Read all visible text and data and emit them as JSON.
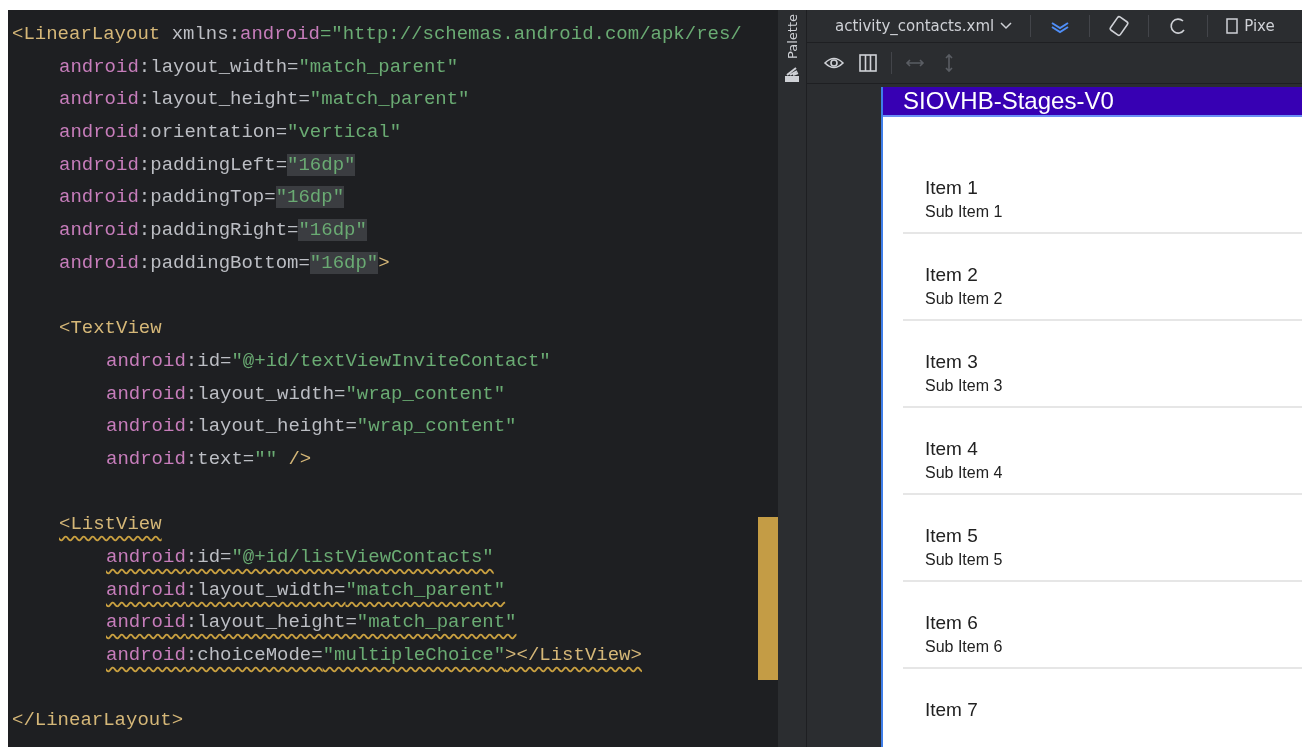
{
  "editor": {
    "lines": [
      {
        "kind": "code",
        "tokens": [
          {
            "kind": "tag",
            "text": "<LinearLayout"
          },
          {
            "kind": "plain",
            "text": " xmlns:"
          },
          {
            "kind": "ns",
            "text": "android"
          },
          {
            "kind": "value",
            "text": "=\"http://schemas.android.com/apk/res/"
          }
        ],
        "children": [
          {
            "kind": "code",
            "tokens": [
              {
                "kind": "ns",
                "text": "android"
              },
              {
                "kind": "plain",
                "text": ":layout_width="
              },
              {
                "kind": "value",
                "text": "\"match_parent\""
              }
            ]
          },
          {
            "kind": "code",
            "tokens": [
              {
                "kind": "ns",
                "text": "android"
              },
              {
                "kind": "plain",
                "text": ":layout_height="
              },
              {
                "kind": "value",
                "text": "\"match_parent\""
              }
            ]
          },
          {
            "kind": "code",
            "tokens": [
              {
                "kind": "ns",
                "text": "android"
              },
              {
                "kind": "plain",
                "text": ":orientation="
              },
              {
                "kind": "value",
                "text": "\"vertical\""
              }
            ]
          },
          {
            "kind": "code",
            "tokens": [
              {
                "kind": "ns",
                "text": "android"
              },
              {
                "kind": "plain",
                "text": ":paddingLeft="
              },
              {
                "kind": "value",
                "text": "\"16dp\"",
                "highlighted": true
              }
            ]
          },
          {
            "kind": "code",
            "tokens": [
              {
                "kind": "ns",
                "text": "android"
              },
              {
                "kind": "plain",
                "text": ":paddingTop="
              },
              {
                "kind": "value",
                "text": "\"16dp\"",
                "highlighted": true
              }
            ]
          },
          {
            "kind": "code",
            "tokens": [
              {
                "kind": "ns",
                "text": "android"
              },
              {
                "kind": "plain",
                "text": ":paddingRight="
              },
              {
                "kind": "value",
                "text": "\"16dp\"",
                "highlighted": true
              }
            ]
          },
          {
            "kind": "code",
            "tokens": [
              {
                "kind": "ns",
                "text": "android"
              },
              {
                "kind": "plain",
                "text": ":paddingBottom="
              },
              {
                "kind": "value",
                "text": "\"16dp\"",
                "highlighted": true
              },
              {
                "kind": "tag",
                "text": ">"
              }
            ]
          },
          {
            "kind": "blank"
          },
          {
            "kind": "code",
            "tokens": [
              {
                "kind": "tag",
                "text": "<TextView"
              }
            ],
            "children": [
              {
                "kind": "code",
                "tokens": [
                  {
                    "kind": "ns",
                    "text": "android"
                  },
                  {
                    "kind": "plain",
                    "text": ":id="
                  },
                  {
                    "kind": "value",
                    "text": "\"@+id/textViewInviteContact\""
                  }
                ]
              },
              {
                "kind": "code",
                "tokens": [
                  {
                    "kind": "ns",
                    "text": "android"
                  },
                  {
                    "kind": "plain",
                    "text": ":layout_width="
                  },
                  {
                    "kind": "value",
                    "text": "\"wrap_content\""
                  }
                ]
              },
              {
                "kind": "code",
                "tokens": [
                  {
                    "kind": "ns",
                    "text": "android"
                  },
                  {
                    "kind": "plain",
                    "text": ":layout_height="
                  },
                  {
                    "kind": "value",
                    "text": "\"wrap_content\""
                  }
                ]
              },
              {
                "kind": "code",
                "tokens": [
                  {
                    "kind": "ns",
                    "text": "android"
                  },
                  {
                    "kind": "plain",
                    "text": ":text="
                  },
                  {
                    "kind": "value",
                    "text": "\"\""
                  },
                  {
                    "kind": "tag",
                    "text": " />"
                  }
                ]
              }
            ]
          },
          {
            "kind": "blank"
          },
          {
            "kind": "code",
            "warning": true,
            "tokens": [
              {
                "kind": "tag",
                "text": "<ListView"
              }
            ],
            "children": [
              {
                "kind": "code",
                "warning": true,
                "tokens": [
                  {
                    "kind": "ns",
                    "text": "android"
                  },
                  {
                    "kind": "plain",
                    "text": ":id="
                  },
                  {
                    "kind": "value",
                    "text": "\"@+id/listViewContacts\""
                  }
                ]
              },
              {
                "kind": "code",
                "warning": true,
                "tokens": [
                  {
                    "kind": "ns",
                    "text": "android"
                  },
                  {
                    "kind": "plain",
                    "text": ":layout_width="
                  },
                  {
                    "kind": "value",
                    "text": "\"match_parent\""
                  }
                ]
              },
              {
                "kind": "code",
                "warning": true,
                "tokens": [
                  {
                    "kind": "ns",
                    "text": "android"
                  },
                  {
                    "kind": "plain",
                    "text": ":layout_height="
                  },
                  {
                    "kind": "value",
                    "text": "\"match_parent\""
                  }
                ]
              },
              {
                "kind": "code",
                "warning": true,
                "tokens": [
                  {
                    "kind": "ns",
                    "text": "android"
                  },
                  {
                    "kind": "plain",
                    "text": ":choiceMode="
                  },
                  {
                    "kind": "value",
                    "text": "\"multipleChoice\""
                  },
                  {
                    "kind": "tag",
                    "text": "></ListView>"
                  }
                ]
              }
            ]
          },
          {
            "kind": "blank"
          }
        ]
      },
      {
        "kind": "code",
        "tokens": [
          {
            "kind": "tag",
            "text": "</LinearLayout>"
          }
        ]
      }
    ]
  },
  "palette": {
    "label": "Palette"
  },
  "design_toolbar": {
    "file": "activity_contacts.xml",
    "device": "Pixe"
  },
  "preview": {
    "app_title": "SIOVHB-Stages-V0",
    "items": [
      {
        "title": "Item 1",
        "subtitle": "Sub Item 1"
      },
      {
        "title": "Item 2",
        "subtitle": "Sub Item 2"
      },
      {
        "title": "Item 3",
        "subtitle": "Sub Item 3"
      },
      {
        "title": "Item 4",
        "subtitle": "Sub Item 4"
      },
      {
        "title": "Item 5",
        "subtitle": "Sub Item 5"
      },
      {
        "title": "Item 6",
        "subtitle": "Sub Item 6"
      },
      {
        "title": "Item 7"
      }
    ]
  }
}
